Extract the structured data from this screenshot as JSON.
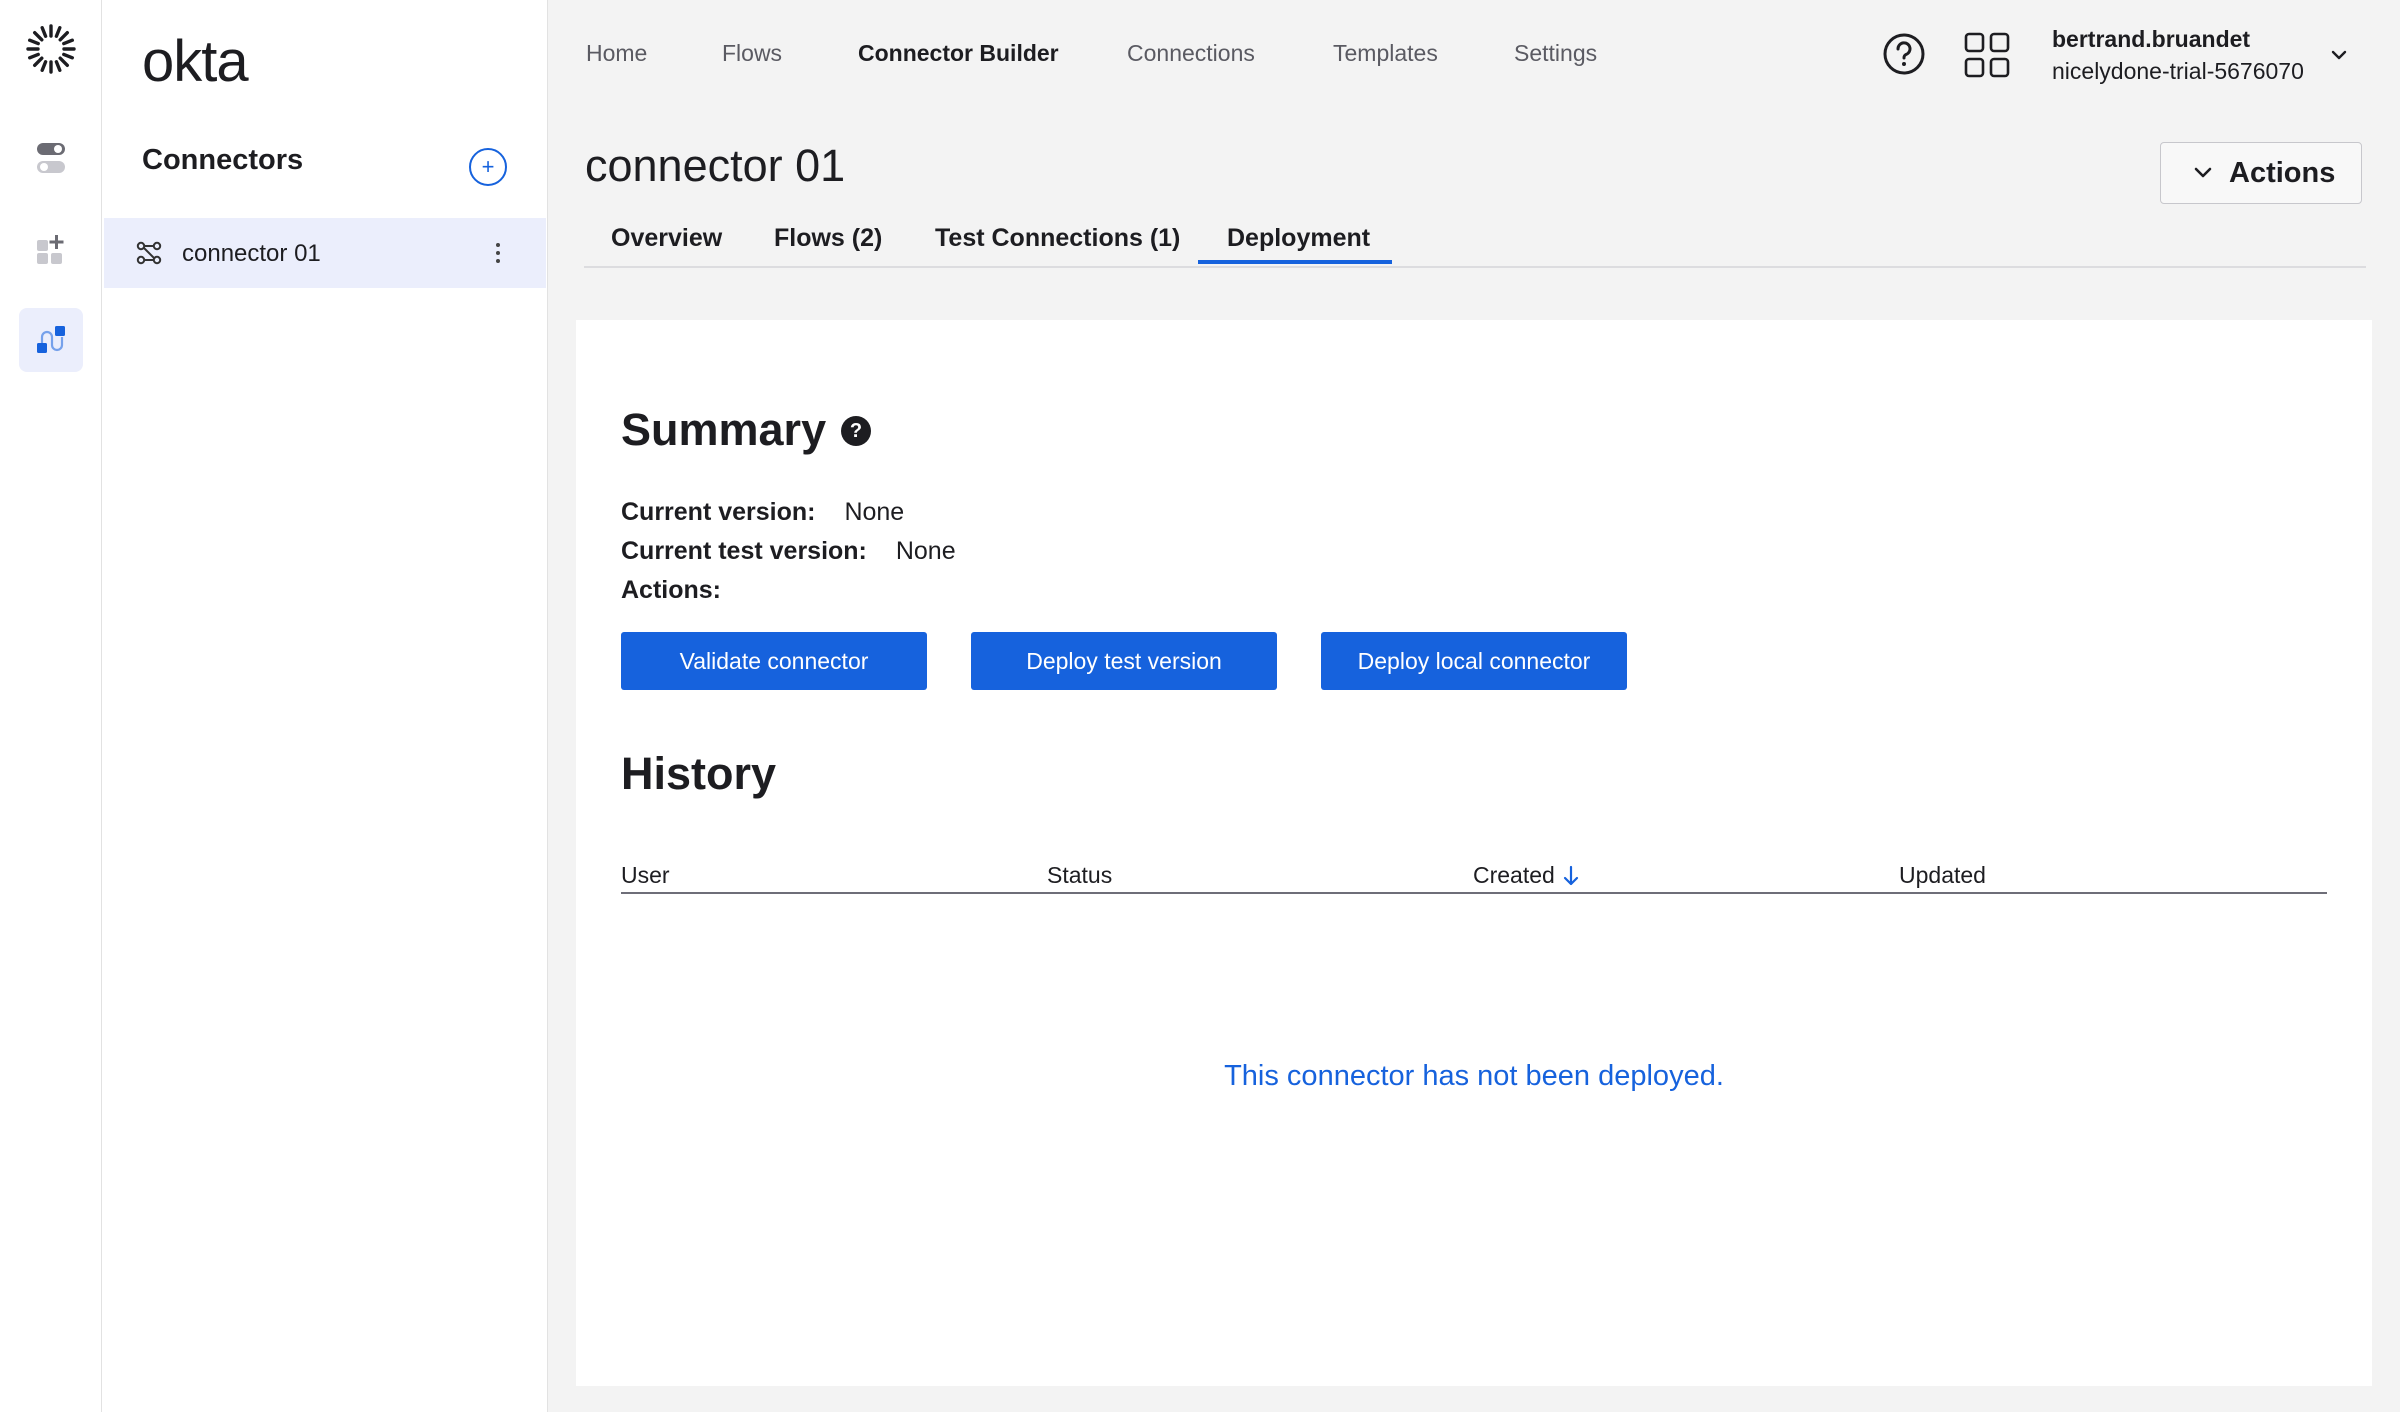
{
  "brand": {
    "name": "okta"
  },
  "rail": {
    "items": [
      {
        "icon": "toggle-icon"
      },
      {
        "icon": "add-app-icon"
      },
      {
        "icon": "connector-builder-icon",
        "active": true
      }
    ]
  },
  "panel": {
    "title": "Connectors",
    "add_icon": "plus-circle-icon",
    "items": [
      {
        "label": "connector 01",
        "icon": "connector-icon",
        "menu_icon": "more-vertical-icon"
      }
    ]
  },
  "nav": {
    "links": [
      "Home",
      "Flows",
      "Connector Builder",
      "Connections",
      "Templates",
      "Settings"
    ],
    "active": "Connector Builder"
  },
  "user": {
    "name": "bertrand.bruandet",
    "org": "nicelydone-trial-5676070"
  },
  "page": {
    "title": "connector 01",
    "actions_label": "Actions"
  },
  "tabs": {
    "items": [
      "Overview",
      "Flows (2)",
      "Test Connections (1)",
      "Deployment"
    ],
    "active": "Deployment"
  },
  "summary": {
    "title": "Summary",
    "help_glyph": "?",
    "current_version_label": "Current version:",
    "current_version_value": "None",
    "current_test_version_label": "Current test version:",
    "current_test_version_value": "None",
    "actions_label": "Actions:",
    "buttons": [
      "Validate connector",
      "Deploy test version",
      "Deploy local connector"
    ]
  },
  "history": {
    "title": "History",
    "columns": [
      "User",
      "Status",
      "Created",
      "Updated"
    ],
    "sorted_column": "Created",
    "sort_direction": "descending",
    "empty_message": "This connector has not been deployed."
  },
  "colors": {
    "accent": "#1662dd",
    "active_bg": "#ebeefc",
    "page_bg": "#f3f3f3"
  }
}
